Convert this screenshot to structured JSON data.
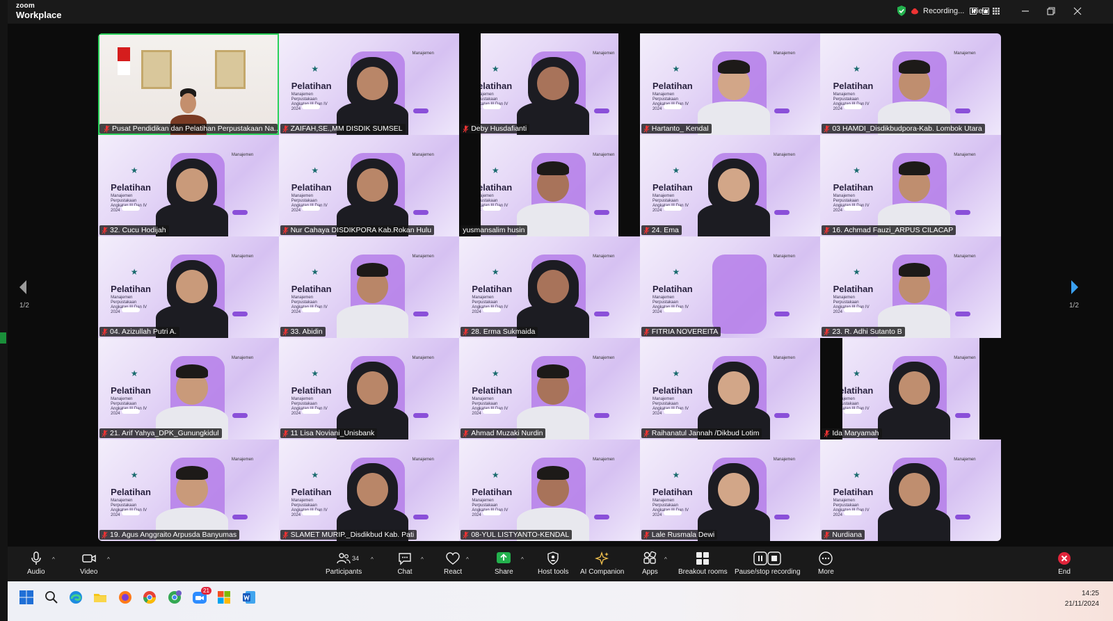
{
  "app": {
    "brand_top": "zoom",
    "brand_bottom": "Workplace"
  },
  "topbar": {
    "recording_label": "Recording...",
    "view_label": "View"
  },
  "gallery": {
    "page_indicator_left": "1/2",
    "page_indicator_right": "1/2",
    "participants": [
      {
        "name": "Pusat Pendidikan dan Pelatihan Perpustakaan Na...",
        "type": "office",
        "active": true,
        "pinned": true
      },
      {
        "name": "ZAIFAH,SE.,MM DISDIK SUMSEL",
        "type": "scarf"
      },
      {
        "name": "Deby Husdafianti",
        "type": "scarf",
        "bars": true
      },
      {
        "name": "Hartanto_ Kendal",
        "type": "man"
      },
      {
        "name": "03 HAMDI_Disdikbudpora-Kab. Lombok Utara",
        "type": "man"
      },
      {
        "name": "32. Cucu Hodijah",
        "type": "scarf"
      },
      {
        "name": "Nur Cahaya DISDIKPORA Kab.Rokan Hulu",
        "type": "scarf"
      },
      {
        "name": "yusmansalim husin",
        "type": "man",
        "bars": true,
        "unmuted": true
      },
      {
        "name": "24. Ema",
        "type": "scarf"
      },
      {
        "name": "16. Achmad Fauzi_ARPUS CILACAP",
        "type": "man"
      },
      {
        "name": "04. Azizullah Putri A.",
        "type": "scarf"
      },
      {
        "name": "33. Abidin",
        "type": "man"
      },
      {
        "name": "28. Erma Sukmaida",
        "type": "scarf"
      },
      {
        "name": "FITRIA NOVEREITA",
        "type": "empty"
      },
      {
        "name": "23. R. Adhi Sutanto B",
        "type": "man"
      },
      {
        "name": "21. Arif Yahya_DPK_Gunungkidul",
        "type": "man"
      },
      {
        "name": "11 Lisa Noviani_Unisbank",
        "type": "scarf"
      },
      {
        "name": "Ahmad Muzaki Nurdin",
        "type": "man"
      },
      {
        "name": "Raihanatul Jannah /Dikbud Lotim",
        "type": "scarf"
      },
      {
        "name": "Ida Maryamah",
        "type": "scarf",
        "bars": true
      },
      {
        "name": "19. Agus Anggraito Arpusda Banyumas",
        "type": "man"
      },
      {
        "name": "SLAMET MURIP._Disdikbud Kab. Pati",
        "type": "scarf"
      },
      {
        "name": "08-YUL LISTYANTO-KENDAL",
        "type": "man"
      },
      {
        "name": "Lale Rusmala Dewi",
        "type": "scarf"
      },
      {
        "name": "Nurdiana",
        "type": "scarf"
      }
    ],
    "background": {
      "headline": "Pelatihan",
      "sub": "Manajemen Perpustakaan Angkatan III Dan IV 2024",
      "right_title": "Manajemen"
    }
  },
  "toolbar": {
    "audio": "Audio",
    "video": "Video",
    "participants": "Participants",
    "participants_count": "34",
    "chat": "Chat",
    "react": "React",
    "share": "Share",
    "host_tools": "Host tools",
    "ai_companion": "AI Companion",
    "apps": "Apps",
    "breakout_rooms": "Breakout rooms",
    "pause_stop_recording": "Pause/stop recording",
    "more": "More",
    "end": "End"
  },
  "taskbar": {
    "time": "14:25",
    "date": "21/11/2024",
    "zoom_badge": "21"
  },
  "colors": {
    "accent_green": "#2ad15a",
    "share_green": "#23b14d",
    "end_red": "#e0243a"
  }
}
